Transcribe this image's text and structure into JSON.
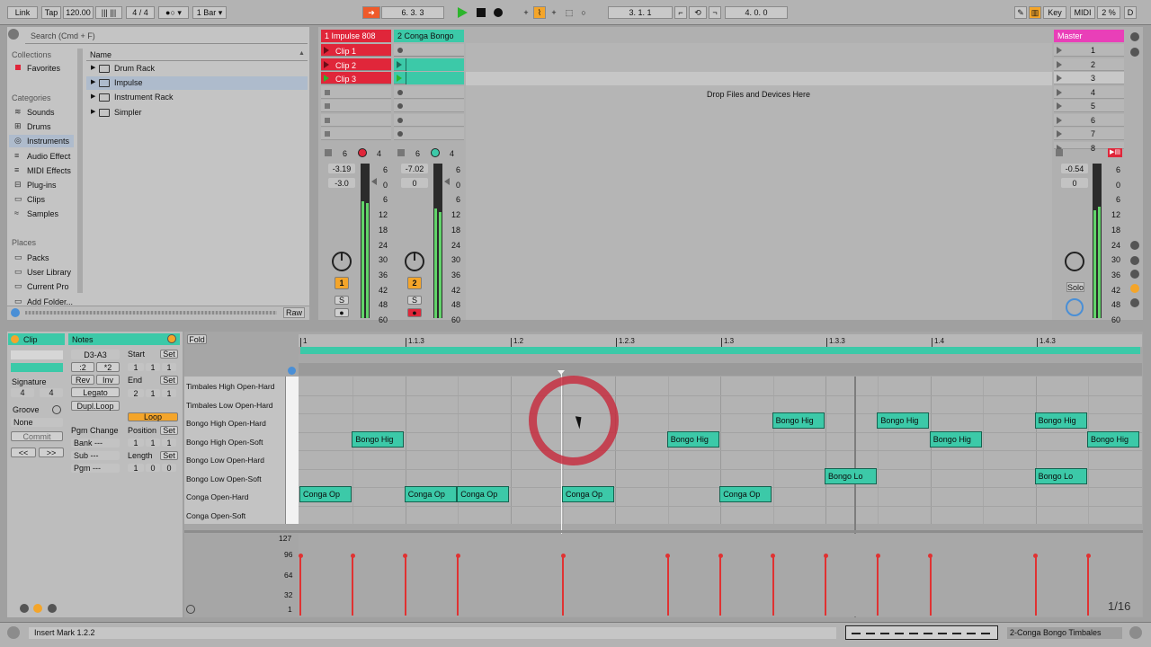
{
  "transport": {
    "link": "Link",
    "tap": "Tap",
    "tempo": "120.00",
    "signature_num": "4",
    "signature_den": "4",
    "quantize": "1 Bar",
    "position": "6.   3.   3",
    "loop_start": "3.   1.   1",
    "loop_length": "4.   0.   0",
    "key": "Key",
    "midi": "MIDI",
    "cpu": "2 %",
    "d": "D"
  },
  "browser": {
    "search_placeholder": "Search (Cmd + F)",
    "collections_label": "Collections",
    "favorites": "Favorites",
    "categories_label": "Categories",
    "categories": [
      "Sounds",
      "Drums",
      "Instruments",
      "Audio Effect",
      "MIDI Effects",
      "Plug-ins",
      "Clips",
      "Samples"
    ],
    "places_label": "Places",
    "places": [
      "Packs",
      "User Library",
      "Current Pro",
      "Add Folder..."
    ],
    "name_header": "Name",
    "items": [
      "Drum Rack",
      "Impulse",
      "Instrument Rack",
      "Simpler"
    ],
    "raw": "Raw"
  },
  "tracks": [
    {
      "name": "1 Impulse 808",
      "color": "#e0263a",
      "clips": [
        "Clip 1",
        "Clip 2",
        "Clip 3"
      ],
      "send_a": "6",
      "send_b": "4",
      "volume": "-3.19",
      "pan": "-3.0",
      "number": "1",
      "solo": "S"
    },
    {
      "name": "2 Conga Bongo",
      "color": "#3cc9a8",
      "clips": [
        "",
        "",
        ""
      ],
      "send_a": "6",
      "send_b": "4",
      "volume": "-7.02",
      "pan": "0",
      "number": "2",
      "solo": "S"
    }
  ],
  "drop_text": "Drop Files and Devices Here",
  "master": {
    "name": "Master",
    "scenes": [
      "1",
      "2",
      "3",
      "4",
      "5",
      "6",
      "7",
      "8"
    ],
    "volume": "-0.54",
    "pan": "0",
    "solo": "Solo"
  },
  "meter_scale": [
    "6",
    "0",
    "6",
    "12",
    "18",
    "24",
    "30",
    "36",
    "42",
    "48",
    "60"
  ],
  "clip_panel": {
    "clip": "Clip",
    "notes": "Notes",
    "range": "D3-A3",
    "half": ":2",
    "double": "*2",
    "rev": "Rev",
    "inv": "Inv",
    "legato": "Legato",
    "dupl": "Dupl.Loop",
    "signature": "Signature",
    "sig_num": "4",
    "sig_den": "4",
    "groove": "Groove",
    "groove_val": "None",
    "commit": "Commit",
    "pgm_change": "Pgm Change",
    "bank": "Bank ---",
    "sub": "Sub ---",
    "pgm": "Pgm ---",
    "start": "Start",
    "end": "End",
    "set": "Set",
    "loop": "Loop",
    "position": "Position",
    "length": "Length",
    "start_vals": [
      "1",
      "1",
      "1"
    ],
    "end_vals": [
      "2",
      "1",
      "1"
    ],
    "pos_vals": [
      "1",
      "1",
      "1"
    ],
    "len_vals": [
      "1",
      "0",
      "0"
    ],
    "nav_prev": "<<",
    "nav_next": ">>"
  },
  "editor": {
    "fold": "Fold",
    "ruler": [
      "1",
      "1.1.3",
      "1.2",
      "1.2.3",
      "1.3",
      "1.3.3",
      "1.4",
      "1.4.3"
    ],
    "lanes": [
      "Timbales High Open-Hard",
      "Timbales Low Open-Hard",
      "Bongo High Open-Hard",
      "Bongo High Open-Soft",
      "Bongo Low Open-Hard",
      "Bongo Low Open-Soft",
      "Conga Open-Hard",
      "Conga Open-Soft"
    ],
    "notes": [
      {
        "label": "Conga Op",
        "lane": 6,
        "beat": 0
      },
      {
        "label": "Bongo Hig",
        "lane": 3,
        "beat": 0.5
      },
      {
        "label": "Conga Op",
        "lane": 6,
        "beat": 1
      },
      {
        "label": "Conga Op",
        "lane": 6,
        "beat": 1.5
      },
      {
        "label": "Conga Op",
        "lane": 6,
        "beat": 2.5
      },
      {
        "label": "Bongo Hig",
        "lane": 3,
        "beat": 3.5
      },
      {
        "label": "Conga Op",
        "lane": 6,
        "beat": 4
      },
      {
        "label": "Bongo Hig",
        "lane": 2,
        "beat": 4.5
      },
      {
        "label": "Bongo Lo",
        "lane": 5,
        "beat": 5
      },
      {
        "label": "Bongo Hig",
        "lane": 2,
        "beat": 5.5
      },
      {
        "label": "Bongo Hig",
        "lane": 3,
        "beat": 6
      },
      {
        "label": "Bongo Hig",
        "lane": 2,
        "beat": 7
      },
      {
        "label": "Bongo Lo",
        "lane": 5,
        "beat": 7
      },
      {
        "label": "Bongo Hig",
        "lane": 3,
        "beat": 7.5
      }
    ],
    "velocity_scale": [
      "127",
      "96",
      "64",
      "32",
      "1"
    ],
    "velocities": [
      0,
      0.5,
      1,
      1.5,
      2.5,
      3.5,
      4,
      4.5,
      5,
      5.5,
      6,
      7,
      7.5
    ],
    "grid": "1/16"
  },
  "status": {
    "message": "Insert Mark 1.2.2",
    "track": "2-Conga Bongo Timbales"
  }
}
